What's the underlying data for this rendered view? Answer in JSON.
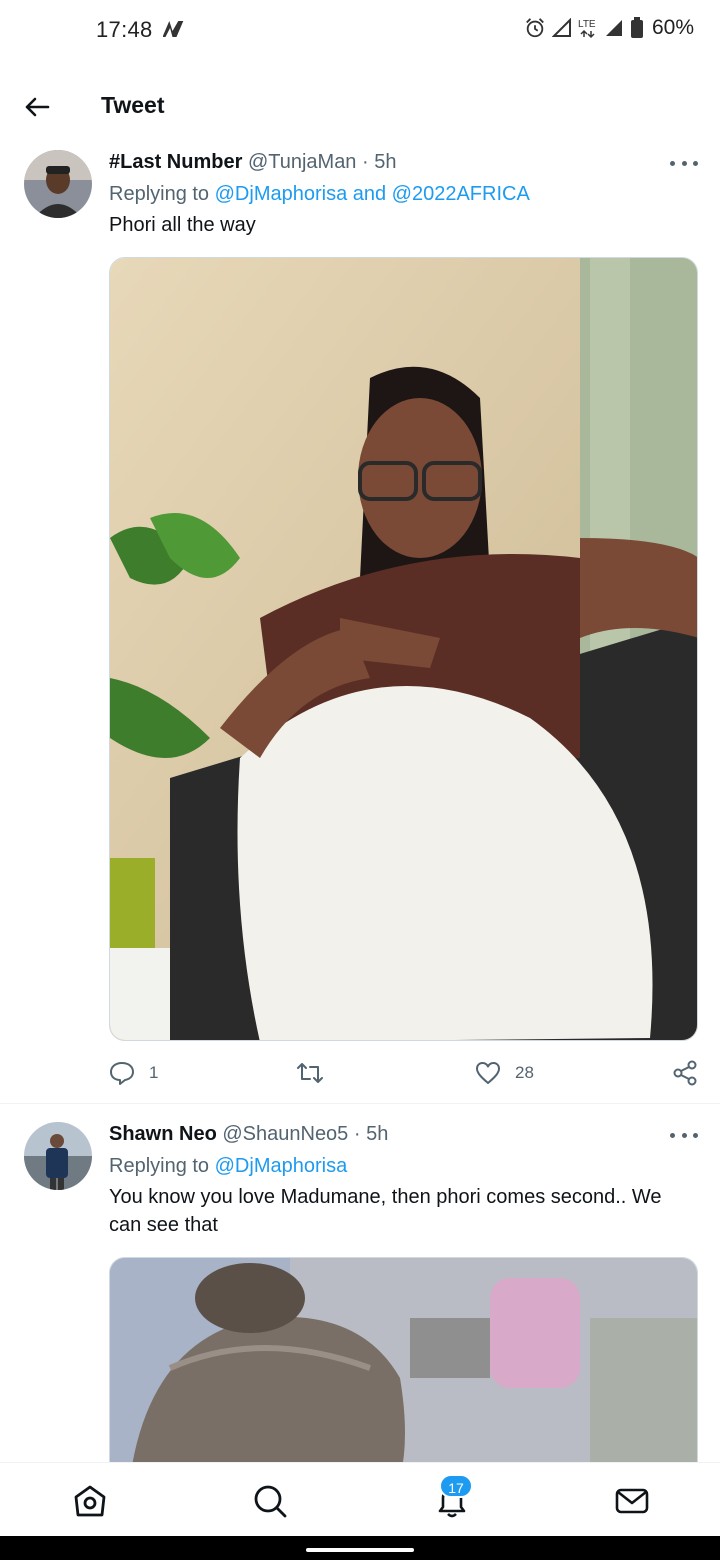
{
  "status_bar": {
    "time": "17:48",
    "battery": "60%",
    "icons": [
      "app-n-icon",
      "alarm-icon",
      "signal-icon",
      "lte-icon",
      "battery-icon"
    ]
  },
  "header": {
    "title": "Tweet",
    "back_icon": "arrow-left-icon"
  },
  "tweets": [
    {
      "name": "#Last Number",
      "handle": "@TunjaMan",
      "separator": "·",
      "time": "5h",
      "replying_prefix": "Replying to",
      "mentions": "@DjMaphorisa and @2022AFRICA",
      "text": "Phori all the way",
      "actions": {
        "reply_count": "1",
        "retweet_count": "",
        "like_count": "28"
      }
    },
    {
      "name": "Shawn Neo",
      "handle": "@ShaunNeo5",
      "separator": "·",
      "time": "5h",
      "replying_prefix": "Replying to",
      "mentions": "@DjMaphorisa",
      "text": "You know you love Madumane, then phori comes second.. We can see that"
    }
  ],
  "bottom_nav": {
    "items": [
      "home-icon",
      "search-icon",
      "notifications-icon",
      "messages-icon"
    ],
    "notification_badge": "17"
  },
  "colors": {
    "accent": "#1d9bf0",
    "secondary_text": "#536471",
    "primary_text": "#0f1419"
  }
}
